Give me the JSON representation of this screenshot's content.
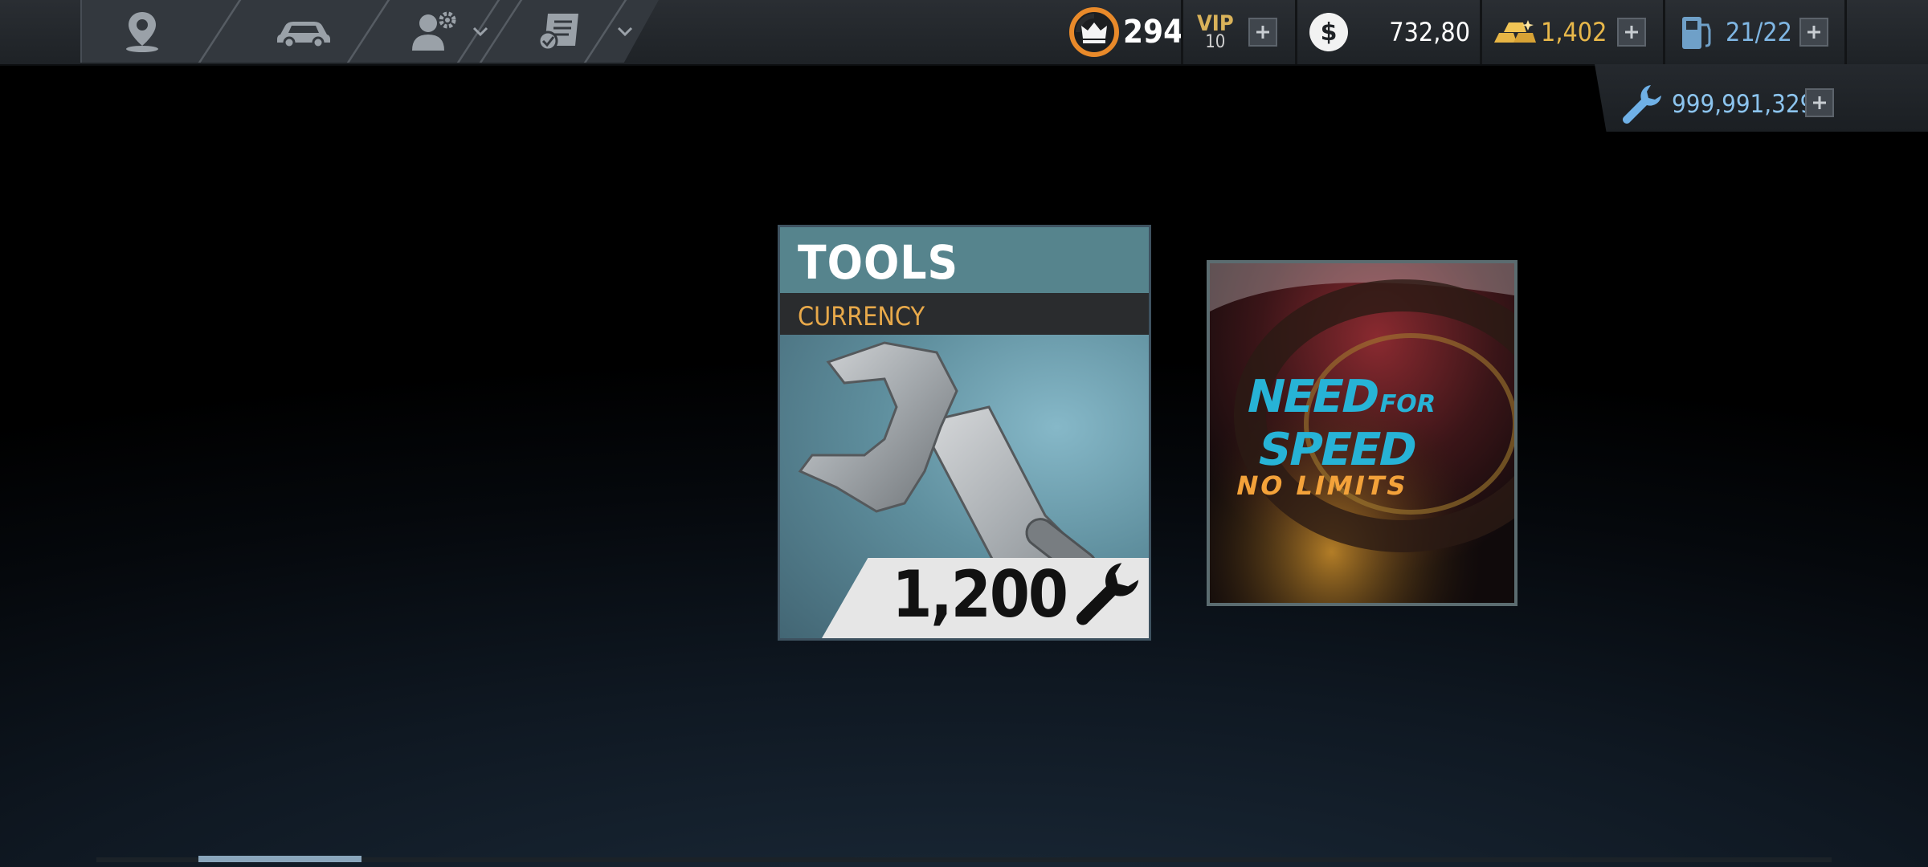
{
  "nav": {
    "tabs": [
      {
        "name": "map-tab",
        "icon": "map-pin-icon"
      },
      {
        "name": "garage-tab",
        "icon": "car-icon"
      },
      {
        "name": "crew-tab",
        "icon": "user-settings-icon"
      },
      {
        "name": "events-tab",
        "icon": "checklist-icon"
      }
    ]
  },
  "status": {
    "rank": "294",
    "vip_label": "VIP",
    "vip_level": "10",
    "cash": "732,80",
    "gold": "1,402",
    "fuel": "21/22",
    "tools_balance": "999,991,329"
  },
  "cards": {
    "tools": {
      "title": "TOOLS",
      "subtitle": "CURRENCY",
      "price": "1,200"
    }
  },
  "logo": {
    "line1": "NEED",
    "line1b": "FOR",
    "line2": "SPEED",
    "line3": "NO LIMITS"
  },
  "colors": {
    "accent_orange": "#e8a94a",
    "vip_gold": "#d9b25a",
    "tools_blue": "#7fb6e3",
    "card_teal": "#56848d",
    "logo_cyan": "#27b3d6",
    "logo_orange": "#f3a23a"
  }
}
